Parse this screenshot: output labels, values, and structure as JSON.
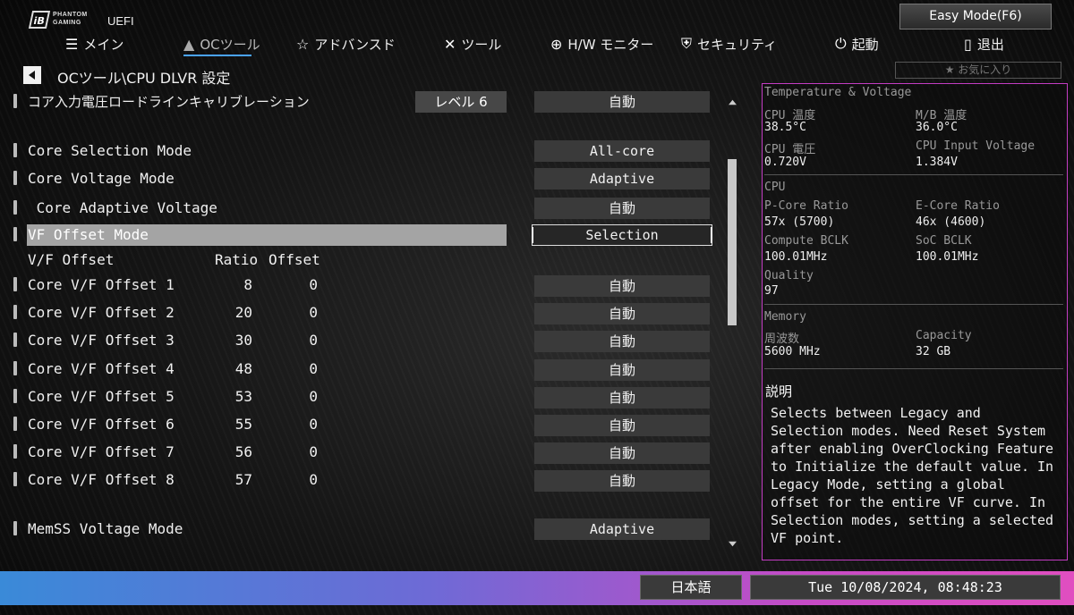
{
  "brand": {
    "logo_mark": "iB",
    "line1": "PHANTOM",
    "line2": "GAMING",
    "uefi": "UEFI"
  },
  "easy_mode": "Easy Mode(F6)",
  "tabs": [
    {
      "label": "メイン",
      "icon": "list-icon"
    },
    {
      "label": "OCツール",
      "icon": "rocket-icon"
    },
    {
      "label": "アドバンスド",
      "icon": "star-icon"
    },
    {
      "label": "ツール",
      "icon": "tools-icon"
    },
    {
      "label": "H/W モニター",
      "icon": "crosshair-icon"
    },
    {
      "label": "セキュリティ",
      "icon": "shield-icon"
    },
    {
      "label": "起動",
      "icon": "power-icon"
    },
    {
      "label": "退出",
      "icon": "exit-icon"
    }
  ],
  "favorites": "★ お気に入り",
  "breadcrumb": "OCツール\\CPU DLVR 設定",
  "settings": {
    "llc": {
      "label": "コア入力電圧ロードラインキャリブレーション",
      "level": "レベル 6",
      "value": "自動"
    },
    "core_selection": {
      "label": "Core Selection Mode",
      "value": "All-core"
    },
    "core_voltage_mode": {
      "label": "Core Voltage Mode",
      "value": "Adaptive"
    },
    "core_adaptive": {
      "label": " Core Adaptive Voltage",
      "value": "自動"
    },
    "vf_offset_mode": {
      "label": "VF Offset Mode",
      "value": "Selection"
    },
    "vf_header": {
      "label": "V/F Offset",
      "ratio": "Ratio",
      "offset": "Offset"
    },
    "vf_rows": [
      {
        "label": "Core V/F Offset 1",
        "ratio": "8",
        "offset": "0",
        "value": "自動"
      },
      {
        "label": "Core V/F Offset 2",
        "ratio": "20",
        "offset": "0",
        "value": "自動"
      },
      {
        "label": "Core V/F Offset 3",
        "ratio": "30",
        "offset": "0",
        "value": "自動"
      },
      {
        "label": "Core V/F Offset 4",
        "ratio": "48",
        "offset": "0",
        "value": "自動"
      },
      {
        "label": "Core V/F Offset 5",
        "ratio": "53",
        "offset": "0",
        "value": "自動"
      },
      {
        "label": "Core V/F Offset 6",
        "ratio": "55",
        "offset": "0",
        "value": "自動"
      },
      {
        "label": "Core V/F Offset 7",
        "ratio": "56",
        "offset": "0",
        "value": "自動"
      },
      {
        "label": "Core V/F Offset 8",
        "ratio": "57",
        "offset": "0",
        "value": "自動"
      }
    ],
    "memss": {
      "label": "MemSS Voltage Mode",
      "value": "Adaptive"
    }
  },
  "monitor": {
    "section_tv": "Temperature & Voltage",
    "cpu_temp_label": "CPU 温度",
    "cpu_temp": "38.5°C",
    "mb_temp_label": "M/B 温度",
    "mb_temp": "36.0°C",
    "cpu_volt_label": "CPU 電圧",
    "cpu_volt": "0.720V",
    "cpu_input_label": "CPU Input Voltage",
    "cpu_input": "1.384V",
    "section_cpu": "CPU",
    "pcore_label": "P-Core Ratio",
    "pcore": "57x (5700)",
    "ecore_label": "E-Core Ratio",
    "ecore": "46x (4600)",
    "bclk_label": "Compute BCLK",
    "bclk": "100.01MHz",
    "soc_label": "SoC BCLK",
    "soc": "100.01MHz",
    "quality_label": "Quality",
    "quality": "97",
    "section_mem": "Memory",
    "freq_label": "周波数",
    "freq": "5600 MHz",
    "cap_label": "Capacity",
    "cap": "32 GB"
  },
  "description": {
    "title": "説明",
    "text": "Selects between Legacy and Selection modes. Need Reset System after enabling OverClocking Feature to Initialize the default value. In Legacy Mode, setting a global offset for the entire VF curve. In Selection modes, setting a selected VF point."
  },
  "footer": {
    "language": "日本語",
    "datetime": "Tue 10/08/2024, 08:48:23"
  }
}
